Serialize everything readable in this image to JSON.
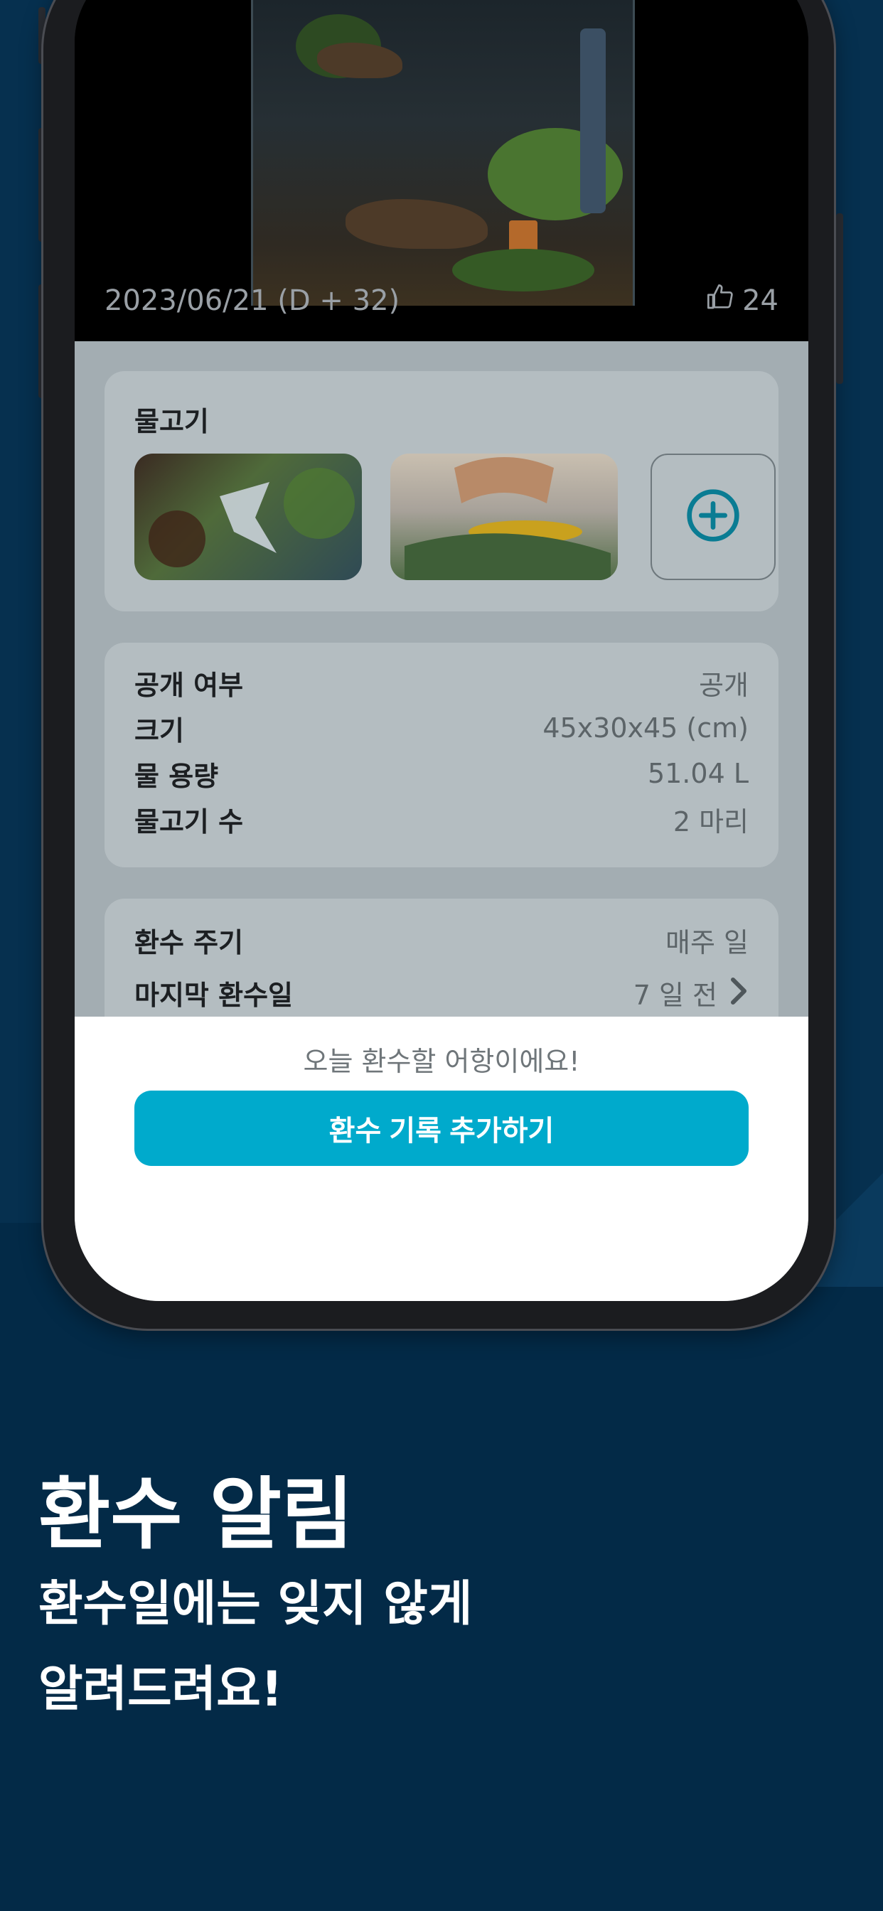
{
  "aquarium": {
    "date": "2023/06/21 (D + 32)",
    "like_count": "24"
  },
  "fish_section": {
    "title": "물고기"
  },
  "info": [
    {
      "label": "공개 여부",
      "value": "공개"
    },
    {
      "label": "크기",
      "value": "45x30x45 (cm)"
    },
    {
      "label": "물 용량",
      "value": "51.04 L"
    },
    {
      "label": "물고기 수",
      "value": "2 마리"
    }
  ],
  "water_change": {
    "cycle_label": "환수 주기",
    "cycle_value": "매주 일",
    "last_label": "마지막 환수일",
    "last_value": "7 일 전"
  },
  "sheet": {
    "message": "오늘 환수할 어항이에요!",
    "button_label": "환수 기록 추가하기"
  },
  "marketing": {
    "headline": "환수 알림",
    "line1": "환수일에는 잊지 않게",
    "line2": "알려드려요!"
  },
  "colors": {
    "accent": "#00aacc",
    "background": "#06304f"
  }
}
